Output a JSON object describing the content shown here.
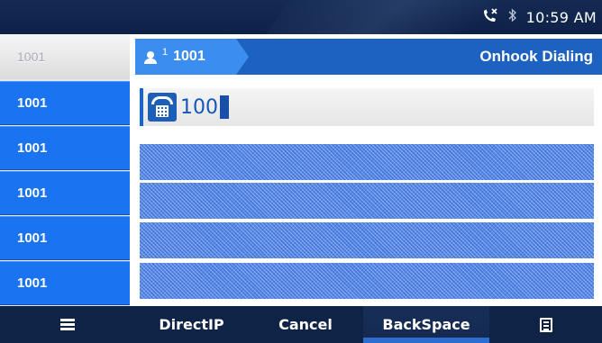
{
  "status": {
    "time": "10:59 AM",
    "icons": [
      "missed-call-icon",
      "bluetooth-icon"
    ]
  },
  "accounts": {
    "header": "1001",
    "items": [
      "1001",
      "1001",
      "1001",
      "1001",
      "1001"
    ]
  },
  "header": {
    "account_index": "1",
    "account_number": "1001",
    "title": "Onhook Dialing"
  },
  "dial": {
    "number": "100"
  },
  "softkeys": {
    "directip": "DirectIP",
    "cancel": "Cancel",
    "backspace": "BackSpace"
  },
  "colors": {
    "accent": "#1a73f0",
    "bar": "#0f2346",
    "header": "#1d62c0"
  }
}
